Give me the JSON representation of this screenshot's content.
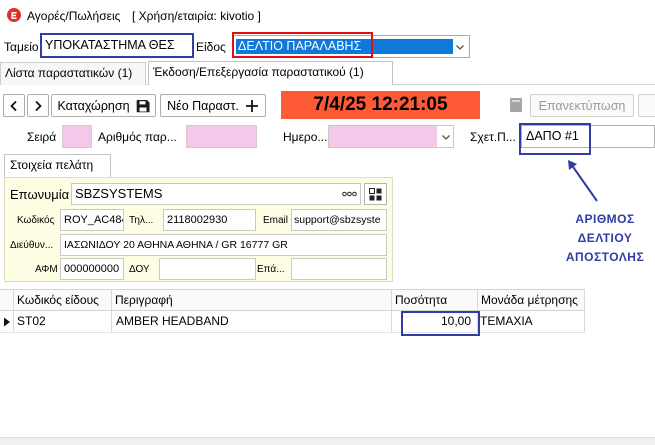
{
  "window": {
    "title": "Αγορές/Πωλήσεις",
    "company": "[ Χρήση/εταιρία: kivotio ]"
  },
  "header": {
    "cashier_label": "Ταμείο",
    "cashier_value": "ΥΠΟΚΑΤΑΣΤΗΜΑ ΘΕΣ",
    "type_label": "Είδος",
    "type_value": "ΔΕΛΤΙΟ ΠΑΡΑΛΑΒΗΣ"
  },
  "tabs": [
    {
      "label": "Λίστα παραστατικών (1)",
      "active": false
    },
    {
      "label": "Έκδοση/Επεξεργασία παραστατικού (1)",
      "active": true
    }
  ],
  "toolbar": {
    "save_label": "Καταχώρηση",
    "new_label": "Νέο Παραστ.",
    "datetime": "7/4/25 12:21:05",
    "reprint_label": "Επανεκτύπωση"
  },
  "document": {
    "series_label": "Σειρά",
    "number_label": "Αριθμός παρ...",
    "date_label": "Ημερο...",
    "related_label": "Σχετ.Π...",
    "related_value": "ΔΑΠΟ #1"
  },
  "customer": {
    "tab_label": "Στοιχεία πελάτη",
    "name_label": "Επωνυμία",
    "name_value": "SBZSYSTEMS",
    "code_label": "Κωδικός",
    "code_value": "ROY_AC484",
    "phone_label": "Τηλ...",
    "phone_value": "2118002930",
    "email_label": "Email",
    "email_value": "support@sbzsyste",
    "address_label": "Διεύθυν...",
    "address_value": "ΙΑΣΩΝΙΔΟΥ 20 ΑΘΗΝΑ ΑΘΗΝΑ / GR 16777 GR",
    "vat_label": "ΑΦΜ",
    "vat_value": "000000000",
    "tax_office_label": "ΔΟΥ",
    "profession_label": "Επά..."
  },
  "annotation": {
    "lines": [
      "ΑΡΙΘΜΟΣ",
      "ΔΕΛΤΙΟΥ",
      "ΑΠΟΣΤΟΛΗΣ"
    ]
  },
  "grid": {
    "columns": [
      "Κωδικός είδους",
      "Περιγραφή",
      "Ποσότητα",
      "Μονάδα μέτρησης"
    ],
    "rows": [
      {
        "code": "ST02",
        "description": "AMBER HEADBAND",
        "quantity": "10,00",
        "unit": "ΤΕΜΑΧΙΑ"
      }
    ]
  },
  "icons": {
    "app": "app-logo-icon",
    "prev": "chevron-left-icon",
    "next": "chevron-right-icon",
    "save": "floppy-disk-icon",
    "new": "plus-icon",
    "document": "document-icon",
    "dropdown": "chevron-down-icon",
    "more": "more-options-icon",
    "lookup": "grid-icon",
    "row_pointer": "row-pointer-icon"
  },
  "colors": {
    "datetime_bg": "#ff5a36",
    "required_field": "#f5c8ea",
    "customer_panel": "#fdfde3",
    "selection": "#0f78d8",
    "annotation_blue": "#2f3da5",
    "annotation_red": "#e01010"
  }
}
